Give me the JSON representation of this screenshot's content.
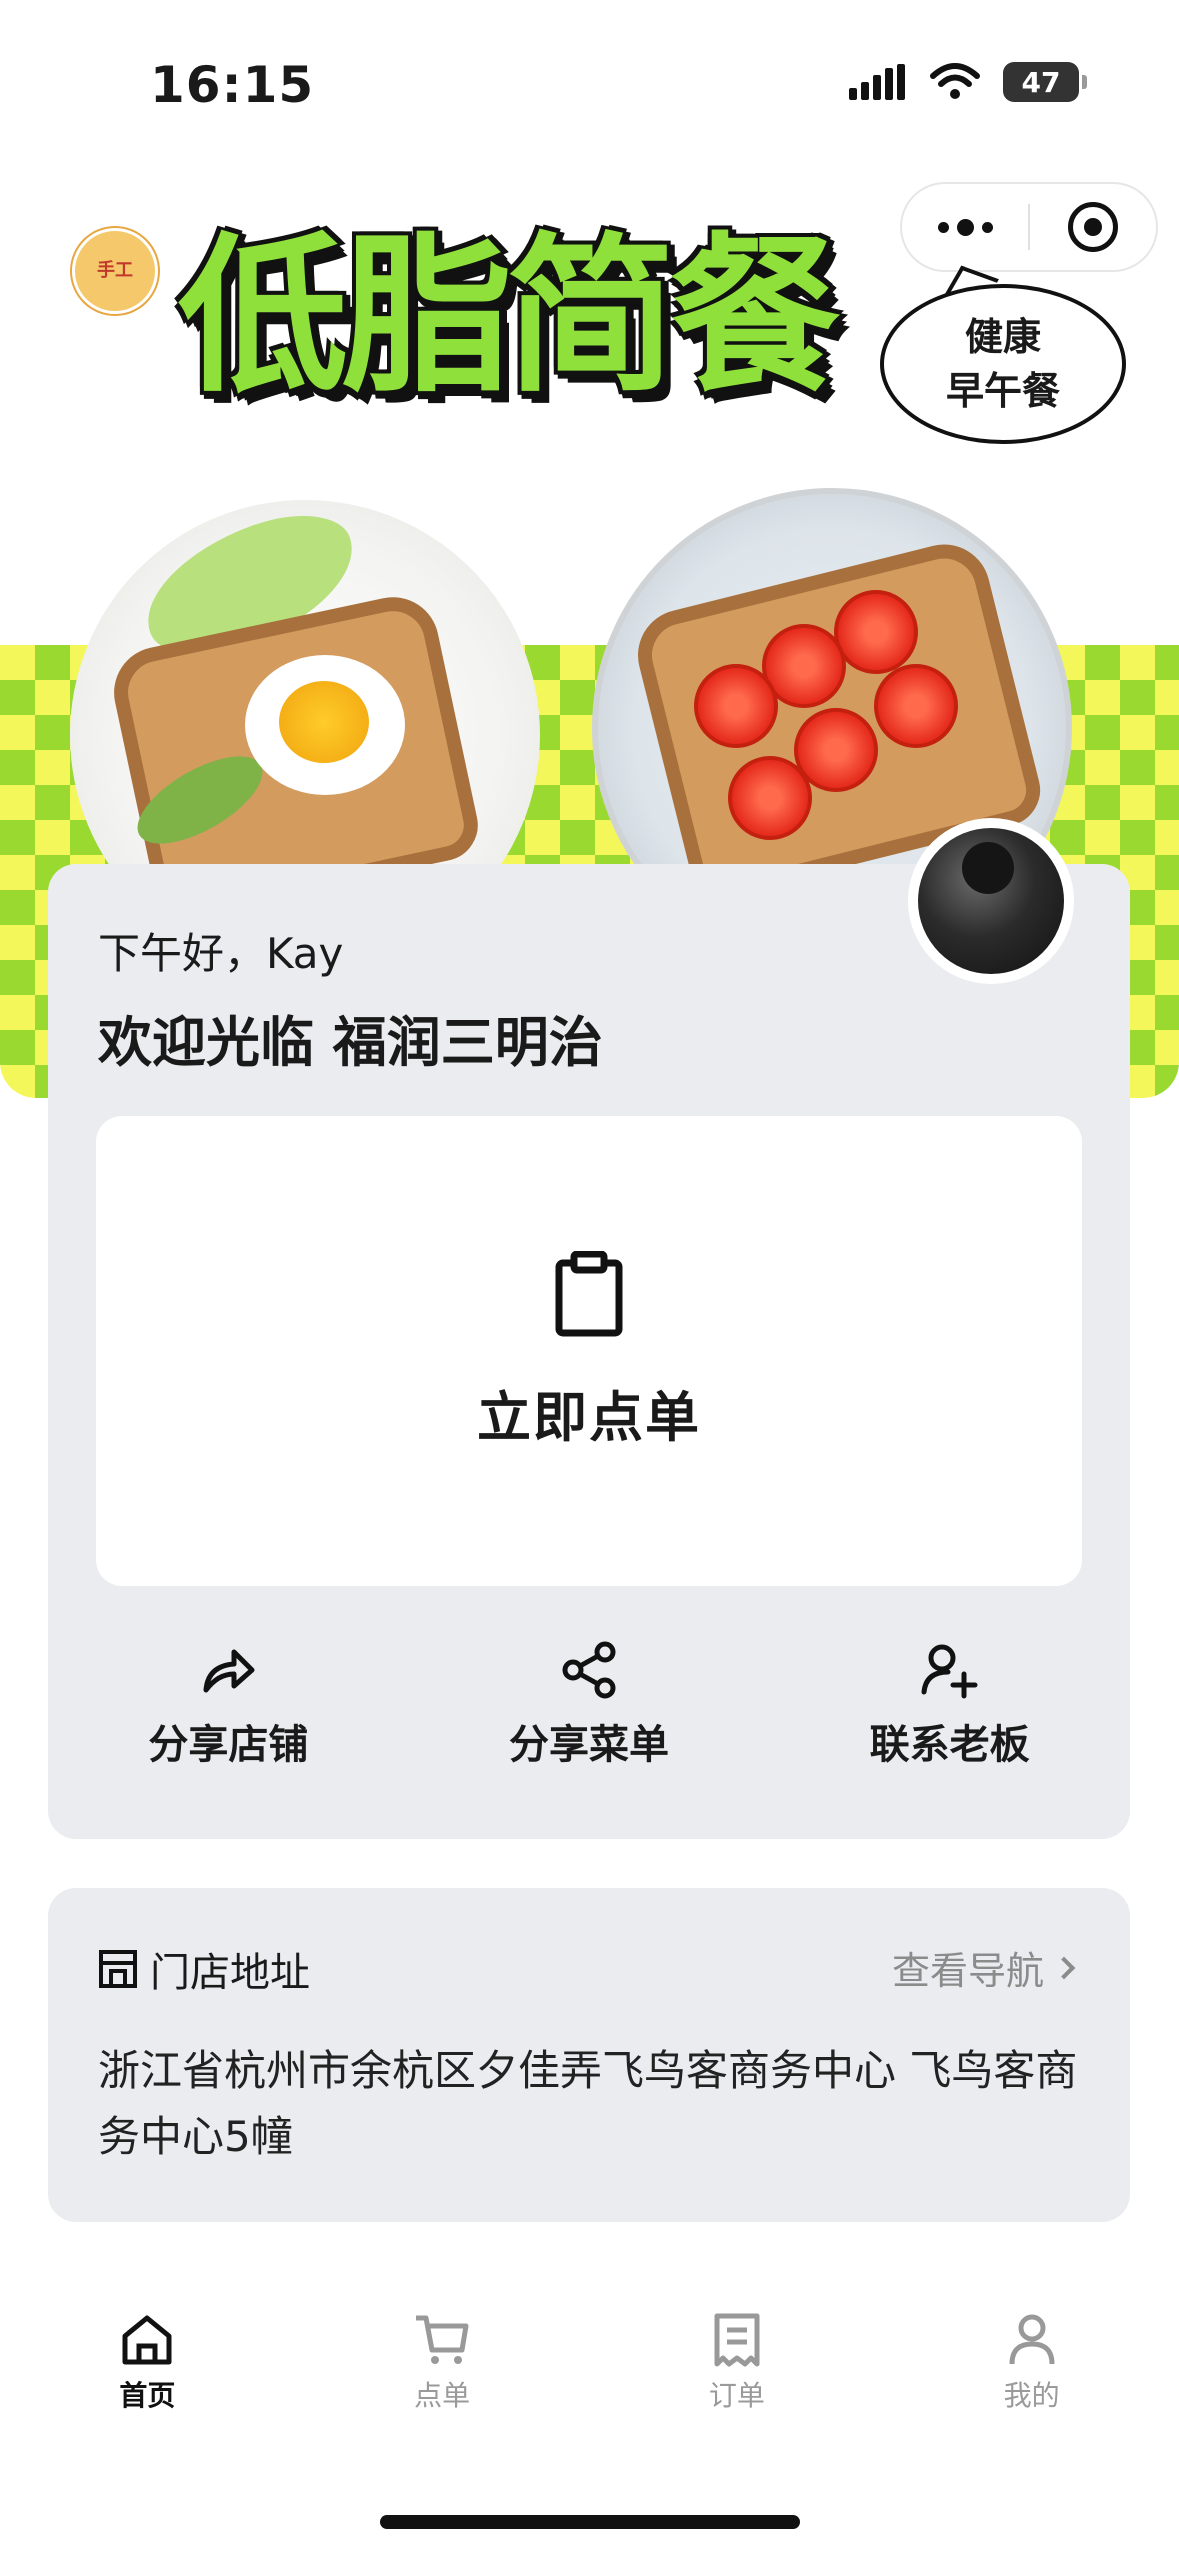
{
  "status_bar": {
    "time": "16:15",
    "battery": "47"
  },
  "banner": {
    "logo_text": "手工",
    "title": "低脂简餐",
    "bubble_line1": "健康",
    "bubble_line2": "早午餐",
    "accent_green": "#8fe03a",
    "accent_yellow": "#f3f75a"
  },
  "main": {
    "greeting": "下午好，Kay",
    "welcome": "欢迎光临 福润三明治",
    "order_button": "立即点单",
    "actions": [
      {
        "label": "分享店铺",
        "icon": "share-arrow-icon"
      },
      {
        "label": "分享菜单",
        "icon": "share-nodes-icon"
      },
      {
        "label": "联系老板",
        "icon": "add-user-icon"
      }
    ]
  },
  "address": {
    "title": "门店地址",
    "nav_label": "查看导航",
    "text": "浙江省杭州市余杭区夕佳弄飞鸟客商务中心 飞鸟客商务中心5幢"
  },
  "tabs": [
    {
      "label": "首页",
      "icon": "home-icon",
      "active": true
    },
    {
      "label": "点单",
      "icon": "cart-icon",
      "active": false
    },
    {
      "label": "订单",
      "icon": "receipt-icon",
      "active": false
    },
    {
      "label": "我的",
      "icon": "person-icon",
      "active": false
    }
  ]
}
